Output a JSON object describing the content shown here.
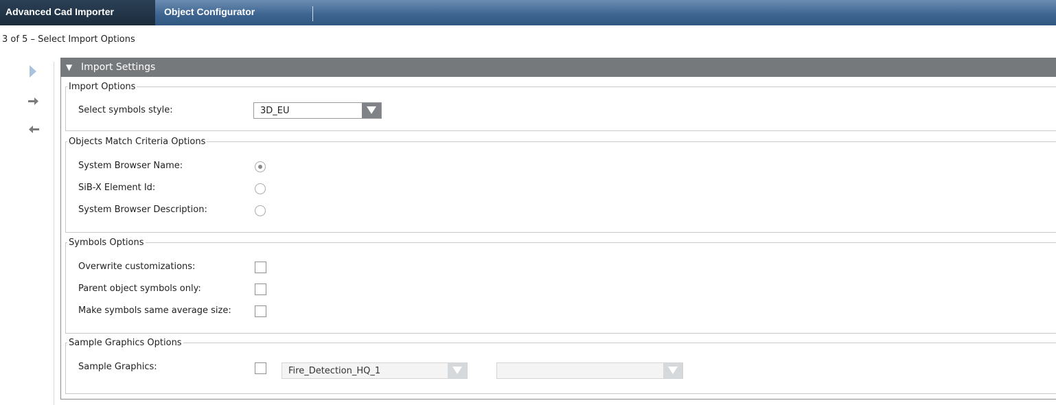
{
  "tabs": [
    {
      "label": "Advanced Cad Importer",
      "active": true
    },
    {
      "label": "Object Configurator",
      "active": false
    }
  ],
  "step_title": "3 of 5 – Select Import Options",
  "nav": {
    "icons": [
      "play-triangle-icon",
      "arrow-right-icon",
      "arrow-left-icon"
    ]
  },
  "panel": {
    "title": "Import Settings",
    "collapse_icon": "triangle-down-icon"
  },
  "import_options": {
    "legend": "Import Options",
    "symbols_style_label": "Select symbols style:",
    "symbols_style_value": "3D_EU"
  },
  "match_criteria": {
    "legend": "Objects Match Criteria Options",
    "options": [
      {
        "label": "System Browser Name:",
        "selected": true
      },
      {
        "label": "SiB-X Element Id:",
        "selected": false
      },
      {
        "label": "System Browser Description:",
        "selected": false
      }
    ]
  },
  "symbols_options": {
    "legend": "Symbols Options",
    "options": [
      {
        "label": "Overwrite customizations:",
        "checked": false
      },
      {
        "label": "Parent object symbols only:",
        "checked": false
      },
      {
        "label": "Make symbols same average size:",
        "checked": false
      }
    ]
  },
  "sample_graphics": {
    "legend": "Sample Graphics Options",
    "label": "Sample Graphics:",
    "checked": false,
    "graphic_value": "Fire_Detection_HQ_1",
    "second_value": ""
  },
  "colors": {
    "tab_bar": "#3f6691",
    "active_tab": "#1c2c3d",
    "panel_header": "#76797b",
    "dropdown_arrow": "#7f8387",
    "nav_play": "#a9c3dc"
  }
}
